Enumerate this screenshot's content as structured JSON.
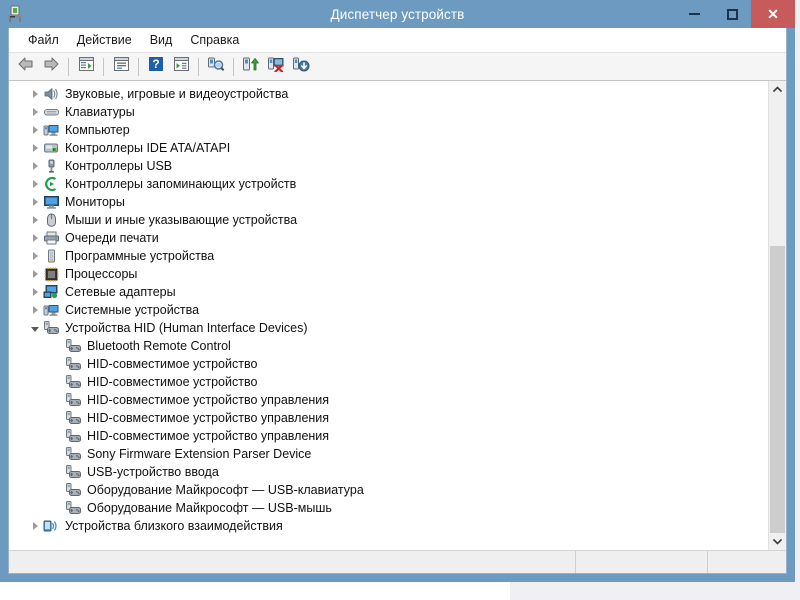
{
  "window": {
    "title": "Диспетчер устройств",
    "app_icon": "device-manager-icon",
    "minimize_label": "Свернуть",
    "maximize_label": "Развернуть",
    "close_label": "Закрыть",
    "accent_color": "#6d9ac0",
    "close_color": "#c75b5b"
  },
  "menubar": {
    "items": [
      {
        "label": "Файл",
        "name": "menu-file"
      },
      {
        "label": "Действие",
        "name": "menu-action"
      },
      {
        "label": "Вид",
        "name": "menu-view"
      },
      {
        "label": "Справка",
        "name": "menu-help"
      }
    ]
  },
  "toolbar": {
    "buttons": [
      {
        "icon": "back-arrow-icon",
        "label": "Назад"
      },
      {
        "icon": "forward-arrow-icon",
        "label": "Вперед"
      },
      {
        "icon": "show-hide-console-tree-icon",
        "label": "Показать/скрыть дерево консоли"
      },
      {
        "icon": "properties-icon",
        "label": "Свойства"
      },
      {
        "icon": "help-icon",
        "label": "Справка"
      },
      {
        "icon": "view-list-icon",
        "label": "Вид"
      },
      {
        "icon": "scan-hardware-changes-icon",
        "label": "Обновить конфигурацию оборудования"
      },
      {
        "icon": "update-driver-icon",
        "label": "Обновить драйверы"
      },
      {
        "icon": "uninstall-device-icon",
        "label": "Удалить устройство"
      },
      {
        "icon": "disable-device-icon",
        "label": "Отключить устройство"
      }
    ]
  },
  "tree": {
    "rows": [
      {
        "indent": 0,
        "state": "collapsed",
        "icon": "sound-video-game-icon",
        "label": "Звуковые, игровые и видеоустройства"
      },
      {
        "indent": 0,
        "state": "collapsed",
        "icon": "keyboard-icon",
        "label": "Клавиатуры"
      },
      {
        "indent": 0,
        "state": "collapsed",
        "icon": "computer-icon",
        "label": "Компьютер"
      },
      {
        "indent": 0,
        "state": "collapsed",
        "icon": "ide-controller-icon",
        "label": "Контроллеры IDE ATA/ATAPI"
      },
      {
        "indent": 0,
        "state": "collapsed",
        "icon": "usb-controller-icon",
        "label": "Контроллеры USB"
      },
      {
        "indent": 0,
        "state": "collapsed",
        "icon": "storage-controller-icon",
        "label": "Контроллеры запоминающих устройств"
      },
      {
        "indent": 0,
        "state": "collapsed",
        "icon": "monitor-icon",
        "label": "Мониторы"
      },
      {
        "indent": 0,
        "state": "collapsed",
        "icon": "mouse-icon",
        "label": "Мыши и иные указывающие устройства"
      },
      {
        "indent": 0,
        "state": "collapsed",
        "icon": "printer-icon",
        "label": "Очереди печати"
      },
      {
        "indent": 0,
        "state": "collapsed",
        "icon": "software-device-icon",
        "label": "Программные устройства"
      },
      {
        "indent": 0,
        "state": "collapsed",
        "icon": "processor-icon",
        "label": "Процессоры"
      },
      {
        "indent": 0,
        "state": "collapsed",
        "icon": "network-adapter-icon",
        "label": "Сетевые адаптеры"
      },
      {
        "indent": 0,
        "state": "collapsed",
        "icon": "system-device-icon",
        "label": "Системные устройства"
      },
      {
        "indent": 0,
        "state": "expanded",
        "icon": "hid-device-icon",
        "label": "Устройства HID (Human Interface Devices)"
      },
      {
        "indent": 1,
        "state": "leaf",
        "icon": "hid-device-icon",
        "label": "Bluetooth Remote Control"
      },
      {
        "indent": 1,
        "state": "leaf",
        "icon": "hid-device-icon",
        "label": "HID-совместимое устройство"
      },
      {
        "indent": 1,
        "state": "leaf",
        "icon": "hid-device-icon",
        "label": "HID-совместимое устройство"
      },
      {
        "indent": 1,
        "state": "leaf",
        "icon": "hid-device-icon",
        "label": "HID-совместимое устройство управления"
      },
      {
        "indent": 1,
        "state": "leaf",
        "icon": "hid-device-icon",
        "label": "HID-совместимое устройство управления"
      },
      {
        "indent": 1,
        "state": "leaf",
        "icon": "hid-device-icon",
        "label": "HID-совместимое устройство управления"
      },
      {
        "indent": 1,
        "state": "leaf",
        "icon": "hid-device-icon",
        "label": "Sony Firmware Extension Parser Device"
      },
      {
        "indent": 1,
        "state": "leaf",
        "icon": "hid-device-icon",
        "label": "USB-устройство ввода"
      },
      {
        "indent": 1,
        "state": "leaf",
        "icon": "hid-device-icon",
        "label": "Оборудование Майкрософт — USB-клавиатура"
      },
      {
        "indent": 1,
        "state": "leaf",
        "icon": "hid-device-icon",
        "label": "Оборудование Майкрософт — USB-мышь"
      },
      {
        "indent": 0,
        "state": "collapsed",
        "icon": "nfc-device-icon",
        "label": "Устройства близкого взаимодействия"
      }
    ]
  },
  "scrollbar": {
    "up_glyph": "▲",
    "down_glyph": "▼",
    "thumb_top_pct": 34,
    "thumb_height_pct": 66
  },
  "statusbar": {
    "cells": [
      "",
      "",
      ""
    ]
  }
}
